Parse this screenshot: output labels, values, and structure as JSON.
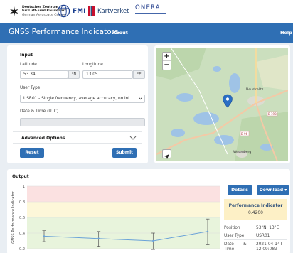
{
  "logos": {
    "dlr": {
      "line1": "Deutsches Zentrum",
      "line2": "für Luft- und Raumfahrt",
      "line3": "German Aerospace Center"
    },
    "fmi": "FMI",
    "kartverket": "Kartverket",
    "onera": "ONERA"
  },
  "nav": {
    "title": "GNSS Performance Indicators",
    "about": "About",
    "help": "Help"
  },
  "input": {
    "title": "Input",
    "latitude_label": "Latitude",
    "latitude_value": "53.34",
    "latitude_unit": "°N",
    "longitude_label": "Longitude",
    "longitude_value": "13.05",
    "longitude_unit": "°E",
    "user_type_label": "User Type",
    "user_type_value": "USR01 - Single frequency, average accuracy, no int",
    "datetime_label": "Date & Time (UTC)",
    "datetime_value": "",
    "advanced_label": "Advanced Options",
    "reset_label": "Reset",
    "submit_label": "Submit"
  },
  "map": {
    "zoom_in": "+",
    "zoom_out": "−",
    "place_1": "Neustrelitz",
    "place_2": "Wesenberg",
    "road_1": "B 96",
    "road_2": "B 198"
  },
  "output": {
    "title": "Output",
    "details_label": "Details",
    "download_label": "Download ▾",
    "performance_title": "Performance Indicator",
    "performance_value": "0.4200",
    "position_label": "Position",
    "position_value": "53°N, 13°E",
    "user_type_label": "User Type",
    "user_type_value": "USR01",
    "datetime_label1": "Date",
    "datetime_label2": "Time",
    "datetime_amp": "&",
    "datetime_value1": "2021-04-14T",
    "datetime_value2": "12:09:08Z"
  },
  "chart_data": {
    "type": "line",
    "ylabel": "GNSS Performance Indicator",
    "ylim": [
      0.2,
      1.0
    ],
    "yticks": [
      "1",
      "0.8",
      "0.6",
      "0.4",
      "0.2"
    ],
    "bands": [
      {
        "from": 0.8,
        "to": 1.0,
        "color": "#fbe1e1"
      },
      {
        "from": 0.6,
        "to": 0.8,
        "color": "#fdf7d9"
      },
      {
        "from": 0.2,
        "to": 0.6,
        "color": "#e8f4dc"
      }
    ],
    "series": [
      {
        "values": [
          0.36,
          0.33,
          0.3,
          0.42
        ],
        "err_low": [
          0.29,
          0.23,
          0.19,
          0.25
        ],
        "err_high": [
          0.43,
          0.42,
          0.4,
          0.58
        ]
      }
    ],
    "grid": true
  }
}
